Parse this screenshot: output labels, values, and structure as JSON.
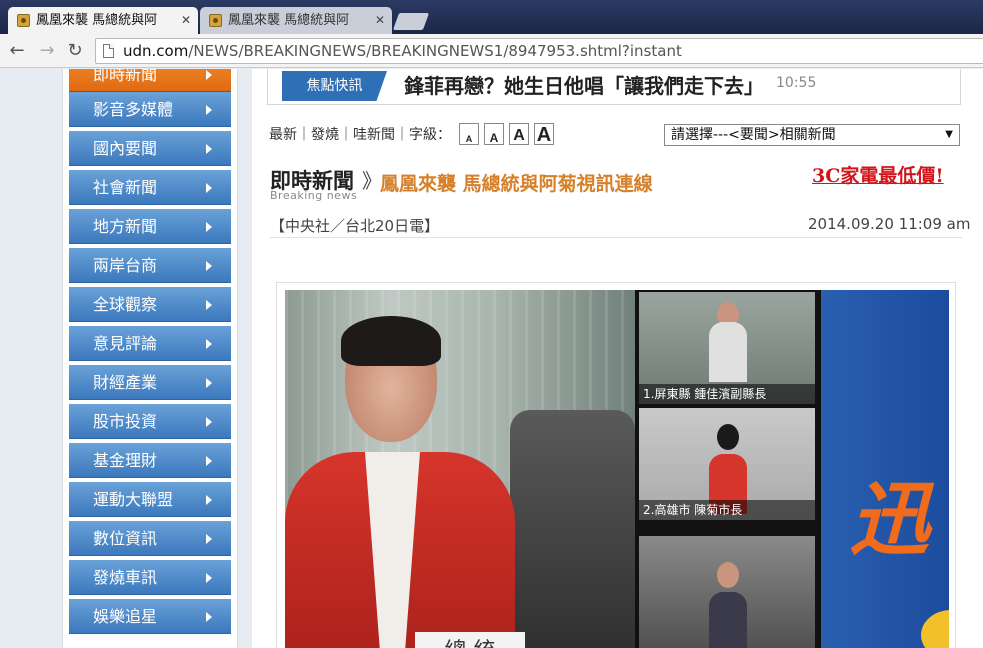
{
  "browser": {
    "tabs": [
      {
        "title": "鳳凰來襲 馬總統與阿",
        "active": true
      },
      {
        "title": "鳳凰來襲 馬總統與阿",
        "active": false
      }
    ],
    "url_host": "udn.com",
    "url_path": "/NEWS/BREAKINGNEWS/BREAKINGNEWS1/8947953.shtml?instant"
  },
  "sidebar": {
    "items": [
      {
        "label": "即時新聞"
      },
      {
        "label": "影音多媒體"
      },
      {
        "label": "國內要聞"
      },
      {
        "label": "社會新聞"
      },
      {
        "label": "地方新聞"
      },
      {
        "label": "兩岸台商"
      },
      {
        "label": "全球觀察"
      },
      {
        "label": "意見評論"
      },
      {
        "label": "財經產業"
      },
      {
        "label": "股市投資"
      },
      {
        "label": "基金理財"
      },
      {
        "label": "運動大聯盟"
      },
      {
        "label": "數位資訊"
      },
      {
        "label": "發燒車訊"
      },
      {
        "label": "娛樂追星"
      }
    ]
  },
  "ticker": {
    "label": "焦點快訊",
    "headline": "鋒菲再戀？她生日他唱「讓我們走下去」",
    "time": "10:55"
  },
  "tools": {
    "links": "最新｜發燒｜哇新聞｜字級：",
    "font_sizes": [
      "A",
      "A",
      "A",
      "A"
    ],
    "related_select": "請選擇---<要聞>相關新聞"
  },
  "article": {
    "section": "即時新聞",
    "section_en": "Breaking news",
    "title": "鳳凰來襲 馬總統與阿菊視訊連線",
    "promo": "3C家電最低價!",
    "byline": "【中央社／台北20日電】",
    "datetime": "2014.09.20 11:09 am"
  },
  "photo": {
    "nameplate": "總 統",
    "captions": [
      "1.屏東縣 鍾佳濱副縣長",
      "2.高雄市 陳菊市長",
      ""
    ],
    "banner_glyph": "迅"
  }
}
